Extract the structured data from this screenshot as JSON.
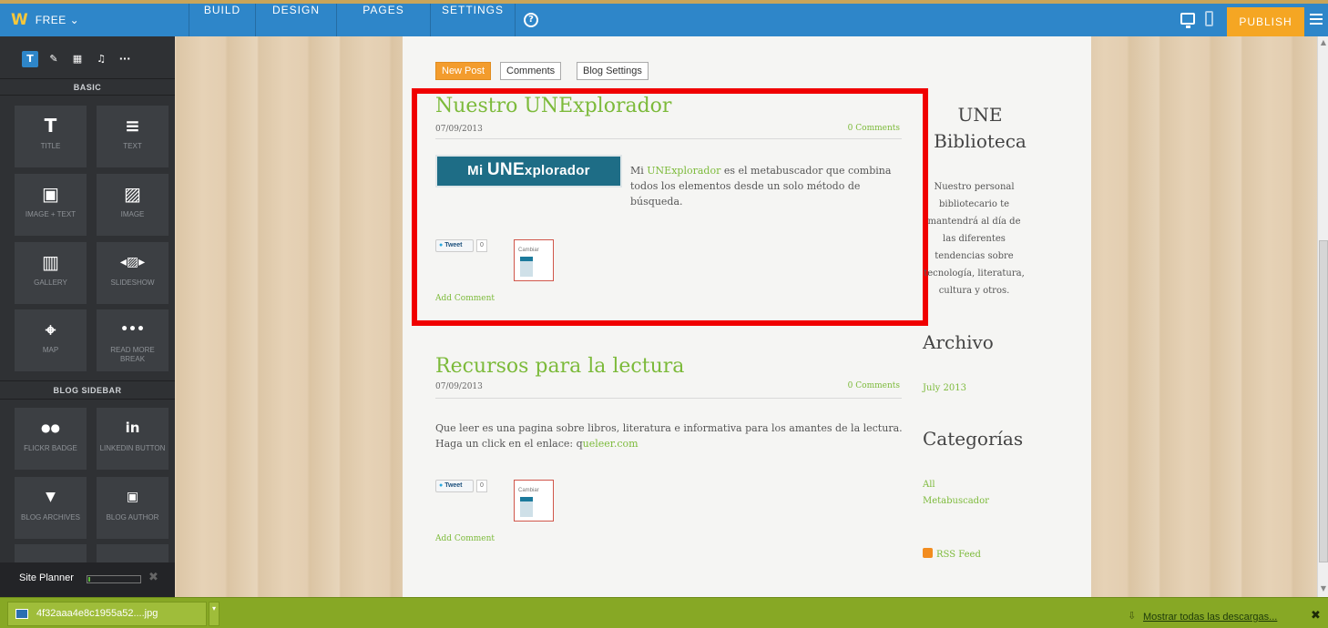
{
  "topbar": {
    "brand_glyph": "W",
    "plan_label": "FREE",
    "nav": [
      "BUILD",
      "DESIGN",
      "PAGES",
      "SETTINGS"
    ],
    "help_glyph": "?",
    "publish_label": "PUBLISH",
    "color": "#2e86c9",
    "publish_color": "#f5a623"
  },
  "sidebar": {
    "tool_tabs": [
      "T",
      "✎",
      "▦",
      "♫",
      "···"
    ],
    "section_basic": "BASIC",
    "basic_tiles": [
      {
        "icon": "T",
        "label": "TITLE"
      },
      {
        "icon": "≡",
        "label": "TEXT"
      },
      {
        "icon": "▣",
        "label": "IMAGE + TEXT"
      },
      {
        "icon": "▨",
        "label": "IMAGE"
      },
      {
        "icon": "▥",
        "label": "GALLERY"
      },
      {
        "icon": "◂▨▸",
        "label": "SLIDESHOW"
      },
      {
        "icon": "⌖",
        "label": "MAP"
      },
      {
        "icon": "•••",
        "label": "READ MORE BREAK"
      }
    ],
    "section_blog": "BLOG SIDEBAR",
    "blog_tiles": [
      {
        "icon": "●●",
        "label": "FLICKR BADGE"
      },
      {
        "icon": "in",
        "label": "LINKEDIN BUTTON"
      },
      {
        "icon": "▼",
        "label": "BLOG ARCHIVES"
      },
      {
        "icon": "▣",
        "label": "BLOG AUTHOR"
      }
    ],
    "site_planner_label": "Site Planner",
    "site_planner_progress": 0.04
  },
  "editor": {
    "new_post": "New Post",
    "comments": "Comments",
    "blog_settings": "Blog Settings"
  },
  "posts": [
    {
      "title": "Nuestro UNExplorador",
      "date": "07/09/2013",
      "comments": "0 Comments",
      "image_text_small": "Mi",
      "image_text_big": "UNE",
      "image_text_rest": "xplorador",
      "body_prefix": "Mi ",
      "body_link": "UNExplorador",
      "body_rest": " es el metabuscador que combina todos los elementos desde un solo método de búsqueda.",
      "tweet": "Tweet",
      "tweet_count": "0",
      "badge_text": "Cambiar",
      "add_comment": "Add Comment"
    },
    {
      "title": "Recursos para la lectura",
      "date": "07/09/2013",
      "comments": "0 Comments",
      "body_line1": "Que leer es una pagina sobre libros, literatura e informativa para los amantes de la lectura.",
      "body_line2_prefix": "Haga un click en el enlace:  q",
      "body_link": "ueleer.com",
      "tweet": "Tweet",
      "tweet_count": "0",
      "badge_text": "Cambiar",
      "add_comment": "Add Comment"
    }
  ],
  "site_sidebar": {
    "title": "UNE Biblioteca",
    "description": "Nuestro personal bibliotecario te mantendrá al día de las diferentes tendencias sobre tecnología, literatura, cultura y otros.",
    "archive_heading": "Archivo",
    "archive_items": [
      "July 2013"
    ],
    "categories_heading": "Categorías",
    "categories": [
      "All",
      "Metabuscador"
    ],
    "rss": "RSS Feed"
  },
  "download_bar": {
    "file_name": "4f32aaa4e8c1955a52....jpg",
    "show_all": "Mostrar todas las descargas..."
  }
}
